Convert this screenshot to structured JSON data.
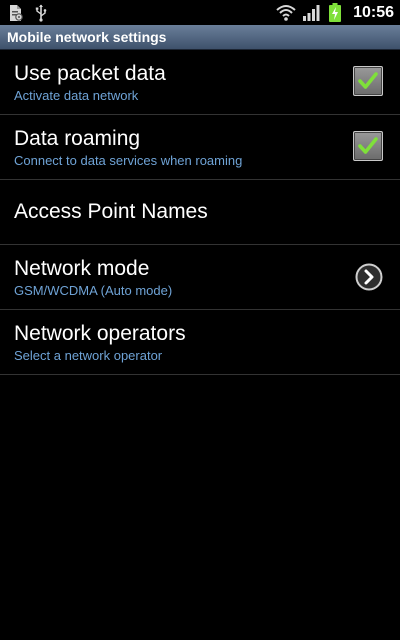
{
  "status_bar": {
    "time": "10:56",
    "icons": [
      "file-sync-icon",
      "usb-icon",
      "wifi-icon",
      "signal-icon",
      "battery-charging-icon"
    ]
  },
  "title_bar": {
    "title": "Mobile network settings"
  },
  "settings": [
    {
      "title": "Use packet data",
      "subtitle": "Activate data network",
      "control": "checkbox",
      "checked": true
    },
    {
      "title": "Data roaming",
      "subtitle": "Connect to data services when roaming",
      "control": "checkbox",
      "checked": true
    },
    {
      "title": "Access Point Names",
      "subtitle": "",
      "control": "none"
    },
    {
      "title": "Network mode",
      "subtitle": "GSM/WCDMA (Auto mode)",
      "control": "chevron-right-icon"
    },
    {
      "title": "Network operators",
      "subtitle": "Select a network operator",
      "control": "none"
    }
  ],
  "colors": {
    "background": "#000000",
    "title_bar": "#4f6380",
    "subtitle": "#6fa3d6",
    "checkmark": "#7fe03a",
    "battery": "#7fe03a"
  }
}
